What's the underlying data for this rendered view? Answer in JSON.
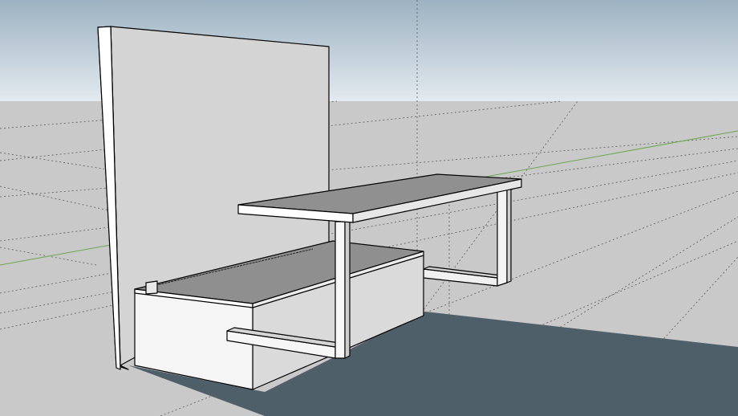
{
  "app": {
    "viewport_name": "3d-model-viewport"
  },
  "colors": {
    "sky_top": "#9fb3c3",
    "sky_bottom": "#dde6ec",
    "ground": "#c9c9c9",
    "shadow": "#4f5f69",
    "grid_line": "#555555",
    "green_axis": "#6aa84f",
    "blue_axis": "#444444",
    "edge": "#000000",
    "face_light": "#ffffff",
    "face_mid": "#d6d6d6",
    "face_dark": "#8c8c8c",
    "face_top": "#909090"
  },
  "scene": {
    "objects": [
      "back-panel",
      "desk-top",
      "desk-leg-front",
      "desk-leg-rear",
      "desk-foot-front",
      "desk-foot-rear",
      "drawer-unit",
      "drawer-top",
      "floor-shadow"
    ]
  }
}
